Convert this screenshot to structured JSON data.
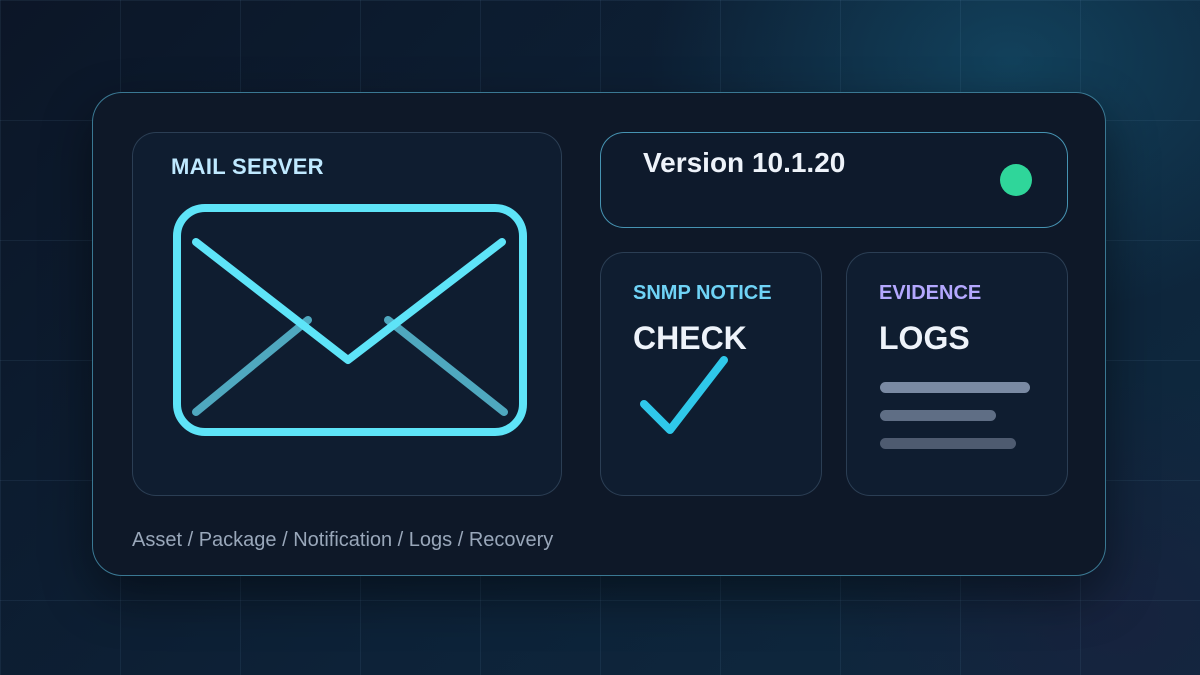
{
  "mail_card": {
    "title": "MAIL SERVER",
    "icon": "envelope-icon"
  },
  "version_card": {
    "label": "Version 10.1.20",
    "status_color": "#2fd69a"
  },
  "snmp_card": {
    "label": "SNMP NOTICE",
    "value": "CHECK",
    "icon": "checkmark-icon",
    "label_color": "#6fd3f6"
  },
  "evidence_card": {
    "label": "EVIDENCE",
    "value": "LOGS",
    "icon": "log-lines-icon",
    "label_color": "#b4a8ff"
  },
  "breadcrumb": "Asset / Package / Notification / Logs / Recovery",
  "colors": {
    "accent": "#5ee4f8",
    "panel_border": "#5ec8eb",
    "background": "#0b1526"
  }
}
